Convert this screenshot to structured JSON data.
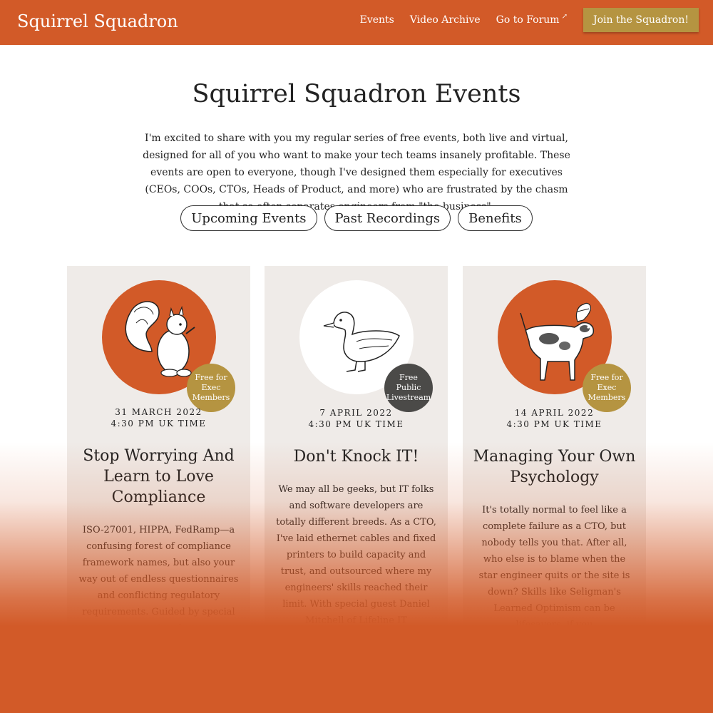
{
  "header": {
    "brand": "Squirrel Squadron",
    "nav": {
      "events": "Events",
      "video_archive": "Video Archive",
      "forum": "Go to Forum",
      "join": "Join the Squadron!"
    }
  },
  "page": {
    "title": "Squirrel Squadron Events",
    "intro": "I'm excited to share with you my regular series of free events, both live and virtual, designed for all of you who want to make your tech teams insanely profitable. These events are open to everyone, though I've designed them especially for executives (CEOs, COOs, CTOs, Heads of Product, and more) who are frustrated by the chasm that so often separates engineers from \"the business\".",
    "pills": [
      "Upcoming Events",
      "Past Recordings",
      "Benefits"
    ]
  },
  "events": [
    {
      "badge_lines": [
        "Free for",
        "Exec",
        "Members"
      ],
      "date": "31 MARCH 2022",
      "time": "4:30 PM UK TIME",
      "title": "Stop Worrying And Learn to Love Compliance",
      "description": "ISO-27001, HIPPA, FedRamp—a confusing forest of compliance framework names, but also your way out of endless questionnaires and conflicting regulatory requirements. Guided by special guest and"
    },
    {
      "badge_lines": [
        "Free",
        "Public",
        "Livestream"
      ],
      "date": "7 APRIL 2022",
      "time": "4:30 PM UK TIME",
      "title": "Don't Knock IT!",
      "description": "We may all be geeks, but IT folks and software developers are totally different breeds. As a CTO, I've laid ethernet cables and fixed printers to build capacity and trust, and outsourced where my engineers' skills reached their limit. With special guest Daniel Mitchell of Lifeline IT"
    },
    {
      "badge_lines": [
        "Free for",
        "Exec",
        "Members"
      ],
      "date": "14 APRIL 2022",
      "time": "4:30 PM UK TIME",
      "title": "Managing Your Own Psychology",
      "description": "It's totally normal to feel like a complete failure as a CTO, but nobody tells you that. After all, who else is to blame when the star engineer quits or the site is down? Skills like Seligman's Learned Optimism can be lifesavers, if you"
    }
  ],
  "colors": {
    "brand_orange": "#d25a28",
    "gold": "#b59441",
    "dark_badge": "#4b4a48",
    "card_bg": "#efebe8"
  },
  "icons": {
    "card1": "squirrel-illustration",
    "card2": "duck-illustration",
    "card3": "dog-chef-hat-illustration",
    "forum": "external-link-icon"
  }
}
